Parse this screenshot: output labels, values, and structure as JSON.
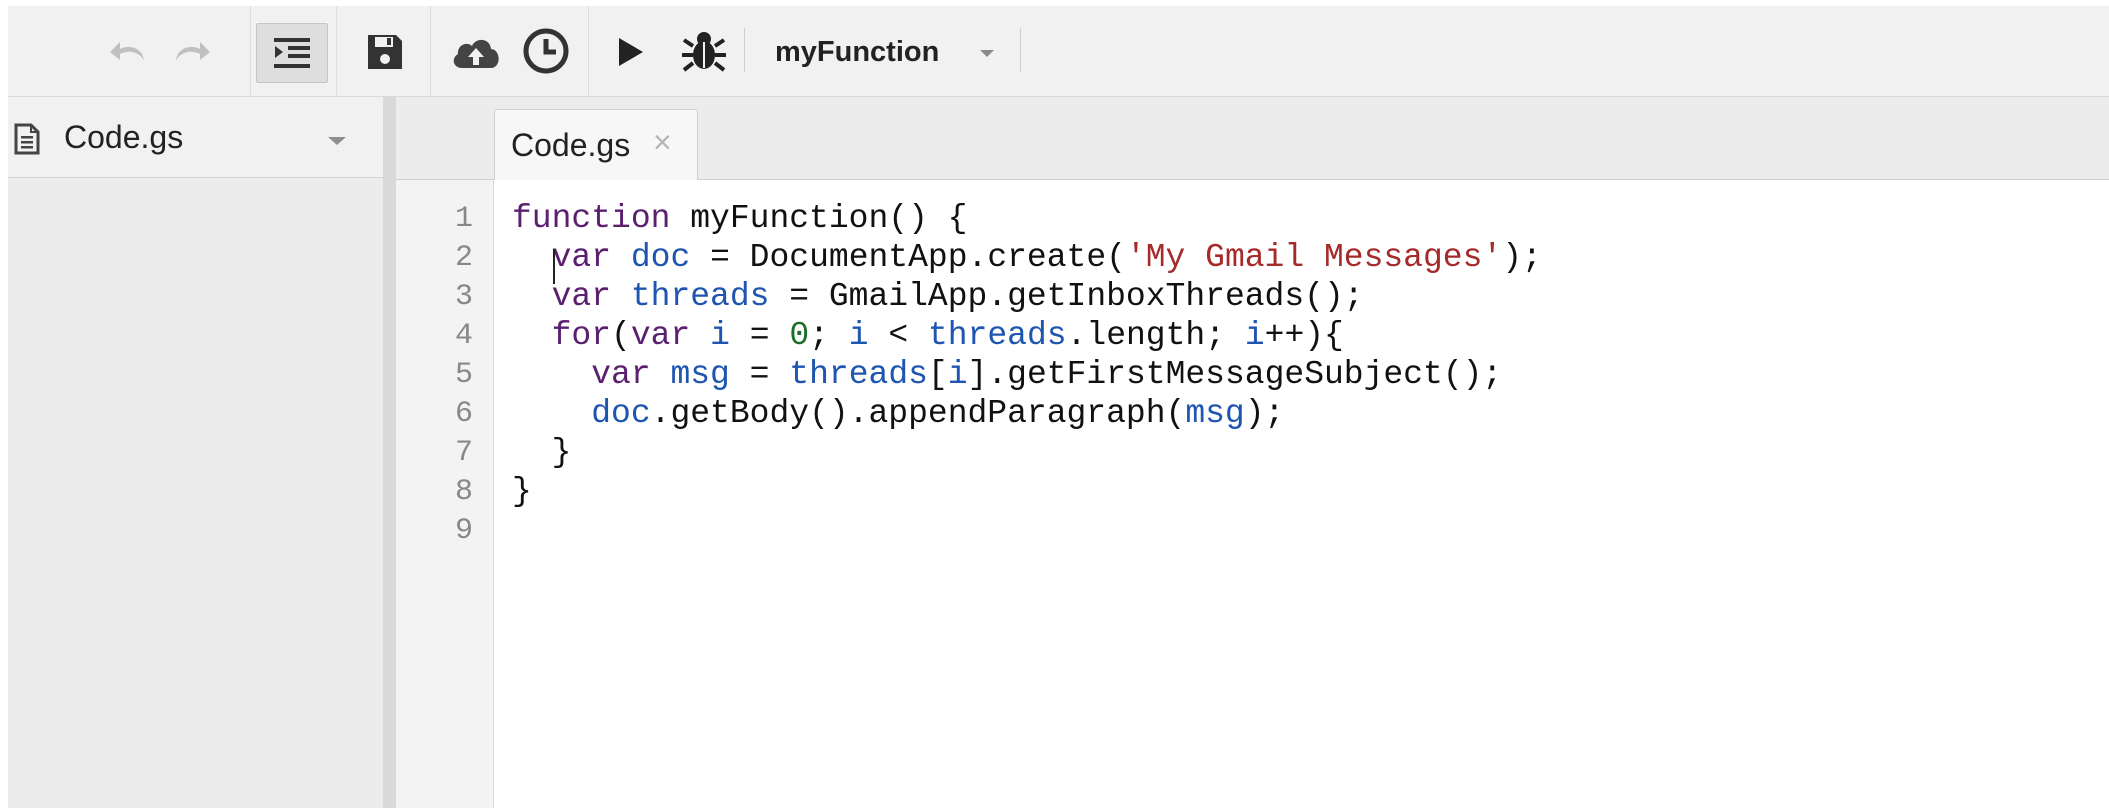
{
  "toolbar": {
    "buttons": [
      {
        "name": "undo-button",
        "icon": "undo-icon"
      },
      {
        "name": "redo-button",
        "icon": "redo-icon"
      },
      {
        "name": "indent-button",
        "icon": "indent-icon"
      },
      {
        "name": "save-button",
        "icon": "floppy-disk-icon"
      },
      {
        "name": "deploy-button",
        "icon": "cloud-upload-icon"
      },
      {
        "name": "triggers-button",
        "icon": "clock-icon"
      },
      {
        "name": "run-button",
        "icon": "play-icon"
      },
      {
        "name": "debug-button",
        "icon": "bug-icon"
      }
    ],
    "function_select": "myFunction"
  },
  "files": [
    {
      "name": "Code.gs",
      "icon": "document-icon"
    }
  ],
  "tabs": [
    {
      "label": "Code.gs",
      "close": "×"
    }
  ],
  "editor": {
    "line_numbers": [
      "1",
      "2",
      "3",
      "4",
      "5",
      "6",
      "7",
      "8",
      "9"
    ],
    "colors": {
      "keyword": "#5a1f6e",
      "variable": "#1d55b0",
      "string": "#a52a2a",
      "number": "#1a6e2a"
    },
    "lines": [
      [
        {
          "t": "function",
          "c": "kw"
        },
        {
          "t": " myFunction() {",
          "c": ""
        }
      ],
      [
        {
          "t": "  ",
          "c": ""
        },
        {
          "t": "var",
          "c": "kw"
        },
        {
          "t": " ",
          "c": ""
        },
        {
          "t": "doc",
          "c": "var"
        },
        {
          "t": " = DocumentApp.create(",
          "c": ""
        },
        {
          "t": "'My Gmail Messages'",
          "c": "str"
        },
        {
          "t": ");",
          "c": ""
        }
      ],
      [
        {
          "t": "  ",
          "c": ""
        },
        {
          "t": "var",
          "c": "kw"
        },
        {
          "t": " ",
          "c": ""
        },
        {
          "t": "threads",
          "c": "var"
        },
        {
          "t": " = GmailApp.getInboxThreads();",
          "c": ""
        }
      ],
      [
        {
          "t": "  ",
          "c": ""
        },
        {
          "t": "for",
          "c": "kw"
        },
        {
          "t": "(",
          "c": ""
        },
        {
          "t": "var",
          "c": "kw"
        },
        {
          "t": " ",
          "c": ""
        },
        {
          "t": "i",
          "c": "var"
        },
        {
          "t": " = ",
          "c": ""
        },
        {
          "t": "0",
          "c": "num"
        },
        {
          "t": "; ",
          "c": ""
        },
        {
          "t": "i",
          "c": "var"
        },
        {
          "t": " < ",
          "c": ""
        },
        {
          "t": "threads",
          "c": "var"
        },
        {
          "t": ".length; ",
          "c": ""
        },
        {
          "t": "i",
          "c": "var"
        },
        {
          "t": "++){",
          "c": ""
        }
      ],
      [
        {
          "t": "    ",
          "c": ""
        },
        {
          "t": "var",
          "c": "kw"
        },
        {
          "t": " ",
          "c": ""
        },
        {
          "t": "msg",
          "c": "var"
        },
        {
          "t": " = ",
          "c": ""
        },
        {
          "t": "threads",
          "c": "var"
        },
        {
          "t": "[",
          "c": ""
        },
        {
          "t": "i",
          "c": "var"
        },
        {
          "t": "].getFirstMessageSubject();",
          "c": ""
        }
      ],
      [
        {
          "t": "    ",
          "c": ""
        },
        {
          "t": "doc",
          "c": "var"
        },
        {
          "t": ".getBody().appendParagraph(",
          "c": ""
        },
        {
          "t": "msg",
          "c": "var"
        },
        {
          "t": ");",
          "c": ""
        }
      ],
      [
        {
          "t": "  }",
          "c": ""
        }
      ],
      [
        {
          "t": "}",
          "c": ""
        }
      ],
      [
        {
          "t": "",
          "c": ""
        }
      ]
    ]
  }
}
